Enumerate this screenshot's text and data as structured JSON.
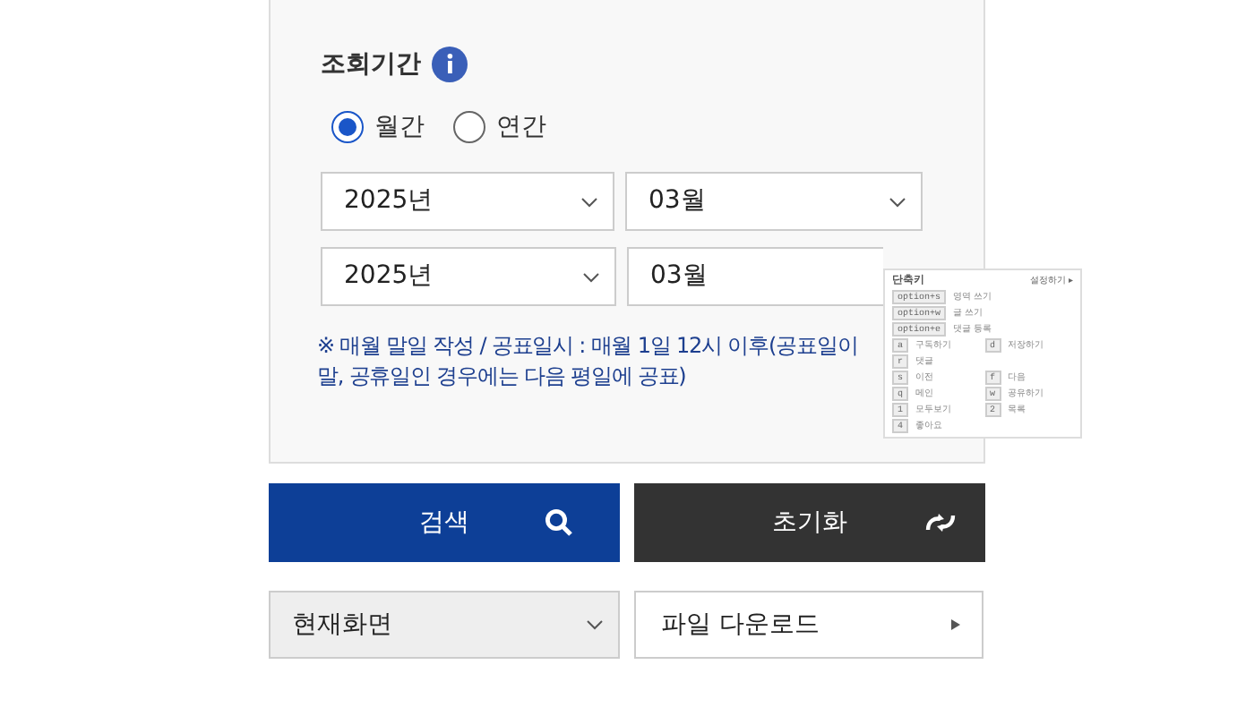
{
  "period": {
    "title": "조회기간",
    "radios": [
      {
        "label": "월간",
        "selected": true
      },
      {
        "label": "연간",
        "selected": false
      }
    ],
    "rows": [
      {
        "year": "2025년",
        "month": "03월"
      },
      {
        "year": "2025년",
        "month": "03월"
      }
    ],
    "note_lines": [
      "※ 매월 말일 작성 / 공표일시 : 매월 1일 12시 이후(공표일이",
      "말, 공휴일인 경우에는 다음 평일에 공표)"
    ]
  },
  "buttons": [
    {
      "label": "검색",
      "kind": "search"
    },
    {
      "label": "초기화",
      "kind": "reset"
    }
  ],
  "view_select": "현재화면",
  "download": "파일 다운로드",
  "shortcut_popup": {
    "title": "단축키",
    "link": "설정하기 ▸",
    "keys": [
      {
        "key": "option+s",
        "label": "영역 쓰기"
      },
      {
        "key": "option+w",
        "label": "글 쓰기"
      },
      {
        "key": "option+e",
        "label": "댓글 등록"
      }
    ],
    "pairs": [
      [
        {
          "key": "a",
          "label": "구독하기"
        },
        {
          "key": "d",
          "label": "저장하기"
        }
      ],
      [
        {
          "key": "r",
          "label": "댓글"
        }
      ],
      [
        {
          "key": "s",
          "label": "이전"
        },
        {
          "key": "f",
          "label": "다음"
        }
      ],
      [
        {
          "key": "q",
          "label": "메인"
        },
        {
          "key": "w",
          "label": "공유하기"
        }
      ],
      [
        {
          "key": "1",
          "label": "모두보기"
        },
        {
          "key": "2",
          "label": "목록"
        }
      ],
      [
        {
          "key": "4",
          "label": "좋아요"
        }
      ]
    ]
  }
}
